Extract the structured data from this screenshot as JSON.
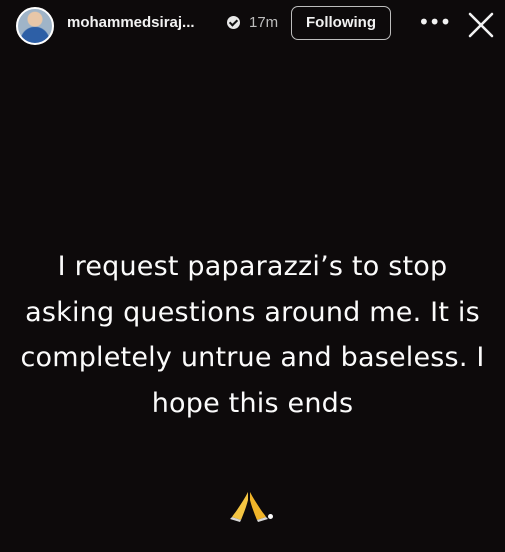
{
  "header": {
    "username": "mohammedsiraj...",
    "verified_icon": "verified-badge-icon",
    "timestamp": "17m",
    "follow_button_label": "Following",
    "more_icon": "more-options-icon",
    "close_icon": "close-icon"
  },
  "story": {
    "message": "I request paparazzi’s to stop asking questions around me. It is completely untrue and baseless. I hope this ends",
    "emoji": "folded-hands-icon",
    "background_color": "#0d0a0b",
    "text_color": "#fbfbfb"
  }
}
